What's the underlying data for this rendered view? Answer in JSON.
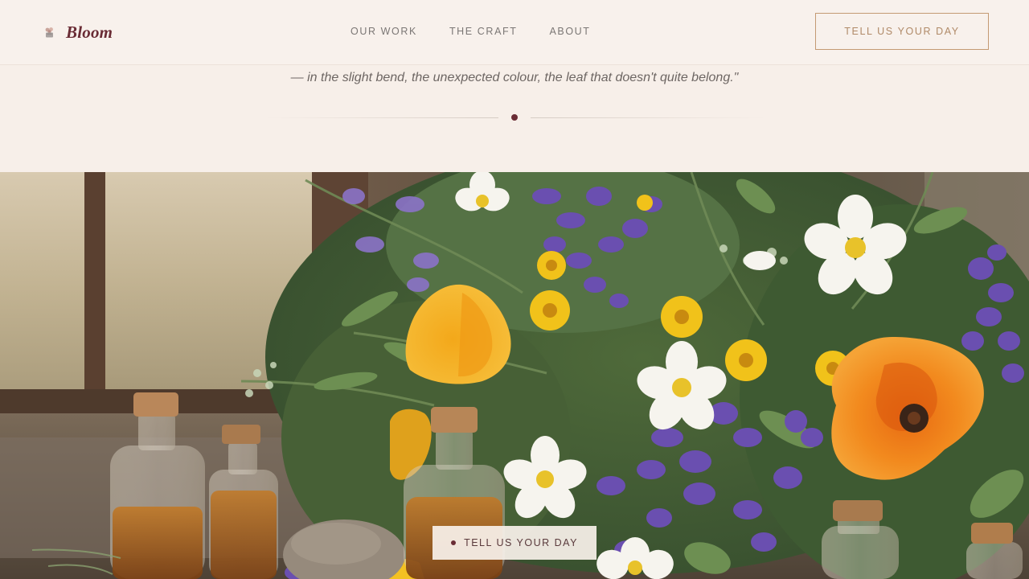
{
  "header": {
    "brand_name": "Bloom",
    "brand_icon": "flower-pot-icon",
    "nav": [
      {
        "label": "OUR WORK"
      },
      {
        "label": "THE CRAFT"
      },
      {
        "label": "ABOUT"
      }
    ],
    "cta_label": "TELL US YOUR DAY"
  },
  "quote": {
    "line": "— in the slight bend, the unexpected colour, the leaf that doesn't quite belong.\""
  },
  "hero": {
    "cta_label": "TELL US YOUR DAY"
  },
  "colors": {
    "accent": "#6a2c35",
    "cta_border": "#c49a73",
    "background": "#f7efe9"
  }
}
